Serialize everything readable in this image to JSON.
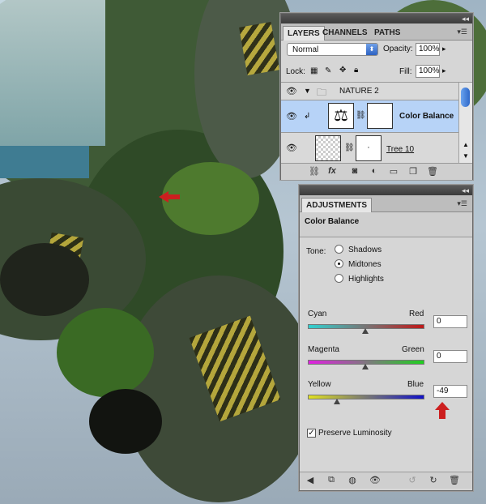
{
  "layers_panel": {
    "tabs": [
      "LAYERS",
      "CHANNELS",
      "PATHS"
    ],
    "blend_mode": "Normal",
    "opacity_label": "Opacity:",
    "opacity_value": "100%",
    "lock_label": "Lock:",
    "fill_label": "Fill:",
    "fill_value": "100%",
    "layers": [
      {
        "name": "NATURE 2",
        "type": "group"
      },
      {
        "name": "Color Balance",
        "type": "adjustment"
      },
      {
        "name": "Tree 10",
        "type": "layer"
      }
    ]
  },
  "adjustments_panel": {
    "tab": "ADJUSTMENTS",
    "title": "Color Balance",
    "tone_label": "Tone:",
    "tones": [
      "Shadows",
      "Midtones",
      "Highlights"
    ],
    "selected_tone": "Midtones",
    "sliders": [
      {
        "left": "Cyan",
        "right": "Red",
        "value": "0",
        "level": 0.5
      },
      {
        "left": "Magenta",
        "right": "Green",
        "value": "0",
        "level": 0.5
      },
      {
        "left": "Yellow",
        "right": "Blue",
        "value": "-49",
        "level": 0.255
      }
    ],
    "preserve_luminosity_label": "Preserve Luminosity",
    "preserve_luminosity": true
  },
  "colors": {
    "arrow": "#cc1f1f",
    "selected_row": "#b7d3f7"
  }
}
